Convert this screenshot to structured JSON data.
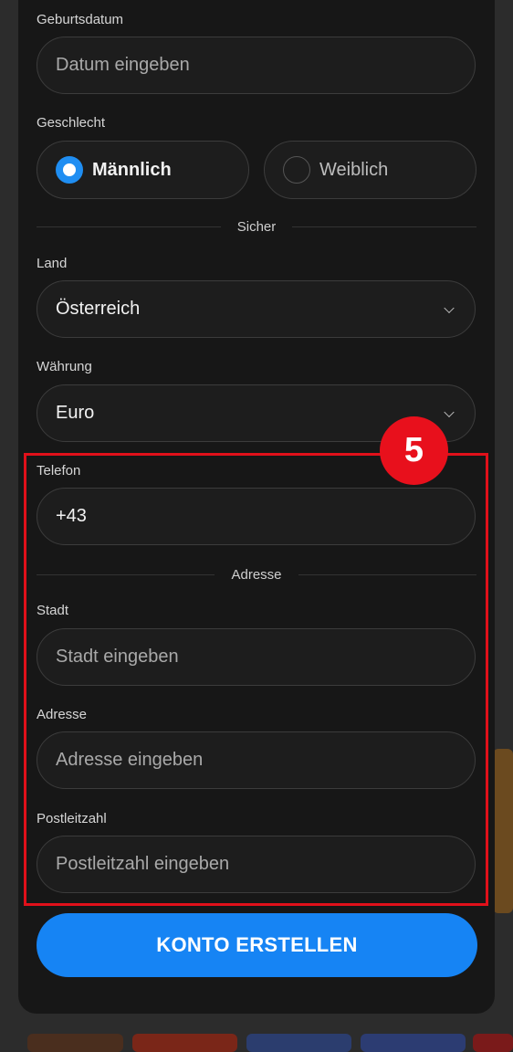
{
  "form": {
    "birthdate": {
      "label": "Geburtsdatum",
      "placeholder": "Datum eingeben"
    },
    "gender": {
      "label": "Geschlecht",
      "options": [
        "Männlich",
        "Weiblich"
      ],
      "selected": "Männlich"
    },
    "section_secure": "Sicher",
    "country": {
      "label": "Land",
      "value": "Österreich"
    },
    "currency": {
      "label": "Währung",
      "value": "Euro"
    },
    "phone": {
      "label": "Telefon",
      "value": "+43"
    },
    "section_address": "Adresse",
    "city": {
      "label": "Stadt",
      "placeholder": "Stadt eingeben"
    },
    "address": {
      "label": "Adresse",
      "placeholder": "Adresse eingeben"
    },
    "postal": {
      "label": "Postleitzahl",
      "placeholder": "Postleitzahl eingeben"
    },
    "submit_label": "KONTO ERSTELLEN"
  },
  "annotation": {
    "step_number": "5",
    "color": "#e0101a"
  },
  "colors": {
    "accent": "#1684f4",
    "panel": "#171717"
  }
}
